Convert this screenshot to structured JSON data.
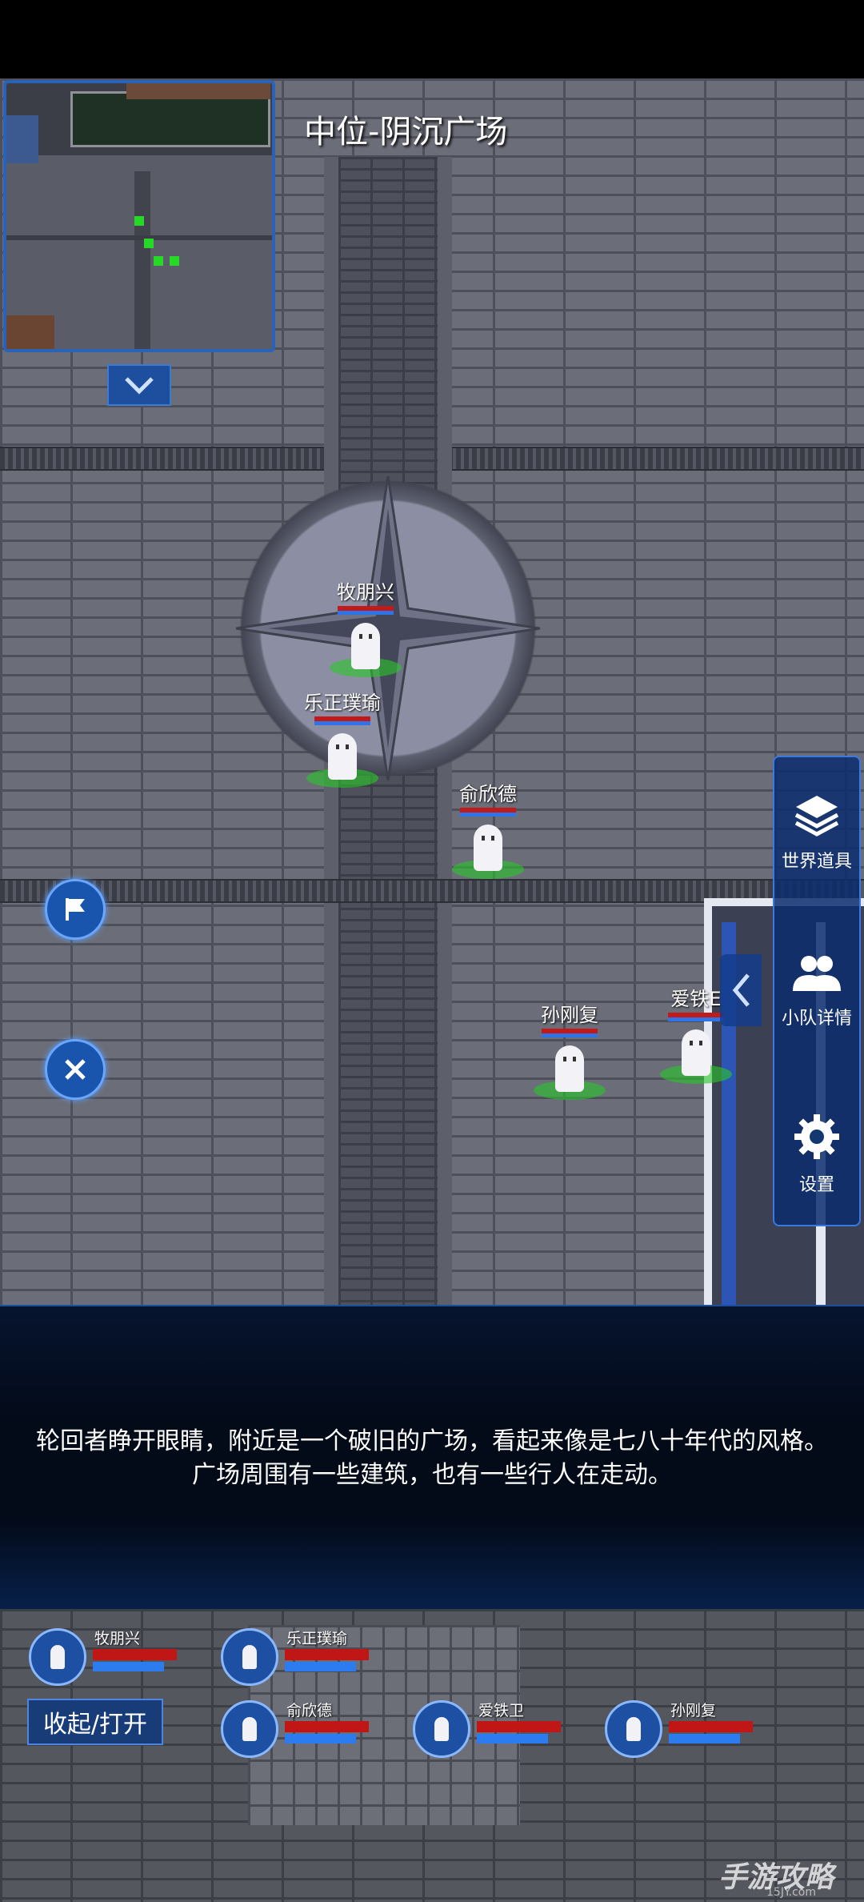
{
  "location_title": "中位-阴沉广场",
  "map_characters": [
    {
      "name": "牧朋兴"
    },
    {
      "name": "乐正璞瑜"
    },
    {
      "name": "俞欣德"
    },
    {
      "name": "孙刚复"
    },
    {
      "name": "爱铁卫"
    }
  ],
  "map_characters_partial_label": "爱铁E",
  "side_menu": {
    "world_items": "世界道具",
    "team_details": "小队详情",
    "settings": "设置"
  },
  "dialog_text": "轮回者睁开眼睛，附近是一个破旧的广场，看起来像是七八十年代的风格。广场周围有一些建筑，也有一些行人在走动。",
  "party": {
    "toggle_label": "收起/打开",
    "members": [
      {
        "name": "牧朋兴",
        "hp": 1.0,
        "mp": 0.85
      },
      {
        "name": "乐正璞瑜",
        "hp": 1.0,
        "mp": 0.85
      },
      {
        "name": "俞欣德",
        "hp": 1.0,
        "mp": 0.85
      },
      {
        "name": "爱铁卫",
        "hp": 1.0,
        "mp": 0.85
      },
      {
        "name": "孙刚复",
        "hp": 1.0,
        "mp": 0.85
      }
    ]
  },
  "watermark": {
    "brand": "手游攻略",
    "site": "15JY.com"
  },
  "icons": {
    "collapse": "chevron-down-icon",
    "flag": "flag-icon",
    "close": "close-icon",
    "layers": "layers-icon",
    "team": "team-icon",
    "gear": "gear-icon",
    "panel_tab": "chevron-left-icon"
  },
  "colors": {
    "hp": "#c21a1a",
    "mp": "#2f74e6",
    "ui_blue": "#1a55ad",
    "selection_green": "#26d926"
  }
}
